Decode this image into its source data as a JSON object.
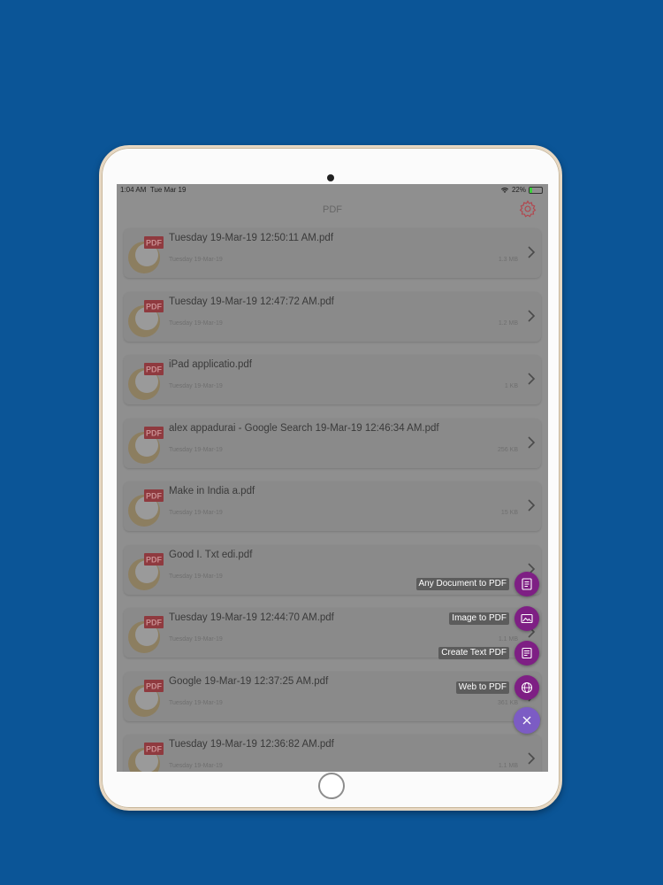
{
  "status_bar": {
    "time": "1:04 AM",
    "date": "Tue Mar 19",
    "battery": "22%",
    "battery_level": 0.22
  },
  "nav": {
    "title": "PDF",
    "settings_icon": "gear-icon"
  },
  "files": [
    {
      "title": "Tuesday 19-Mar-19 12:50:11 AM.pdf",
      "date": "Tuesday 19-Mar-19",
      "size": "1.3 MB"
    },
    {
      "title": "Tuesday 19-Mar-19 12:47:72 AM.pdf",
      "date": "Tuesday 19-Mar-19",
      "size": "1.2 MB"
    },
    {
      "title": "iPad applicatio.pdf",
      "date": "Tuesday 19-Mar-19",
      "size": "1 KB"
    },
    {
      "title": "alex appadurai - Google Search 19-Mar-19 12:46:34 AM.pdf",
      "date": "Tuesday 19-Mar-19",
      "size": "256 KB"
    },
    {
      "title": "Make in India a.pdf",
      "date": "Tuesday 19-Mar-19",
      "size": "15 KB"
    },
    {
      "title": "Good I. Txt edi.pdf",
      "date": "Tuesday 19-Mar-19",
      "size": ""
    },
    {
      "title": "Tuesday 19-Mar-19 12:44:70 AM.pdf",
      "date": "Tuesday 19-Mar-19",
      "size": "1.1 MB"
    },
    {
      "title": "Google 19-Mar-19 12:37:25 AM.pdf",
      "date": "Tuesday 19-Mar-19",
      "size": "361 KB"
    },
    {
      "title": "Tuesday 19-Mar-19 12:36:82 AM.pdf",
      "date": "Tuesday 19-Mar-19",
      "size": "1.1 MB"
    }
  ],
  "fab_menu": {
    "items": [
      {
        "label": "Any Document to PDF",
        "icon": "document-icon"
      },
      {
        "label": "Image to PDF",
        "icon": "image-icon"
      },
      {
        "label": "Create Text PDF",
        "icon": "text-edit-icon"
      },
      {
        "label": "Web to PDF",
        "icon": "globe-icon"
      }
    ],
    "close_icon": "close-icon"
  },
  "colors": {
    "background": "#0b5597",
    "overlay": "#8f8f8f",
    "fab_purple": "#7e1f84",
    "fab_close": "#7c5cc4"
  }
}
